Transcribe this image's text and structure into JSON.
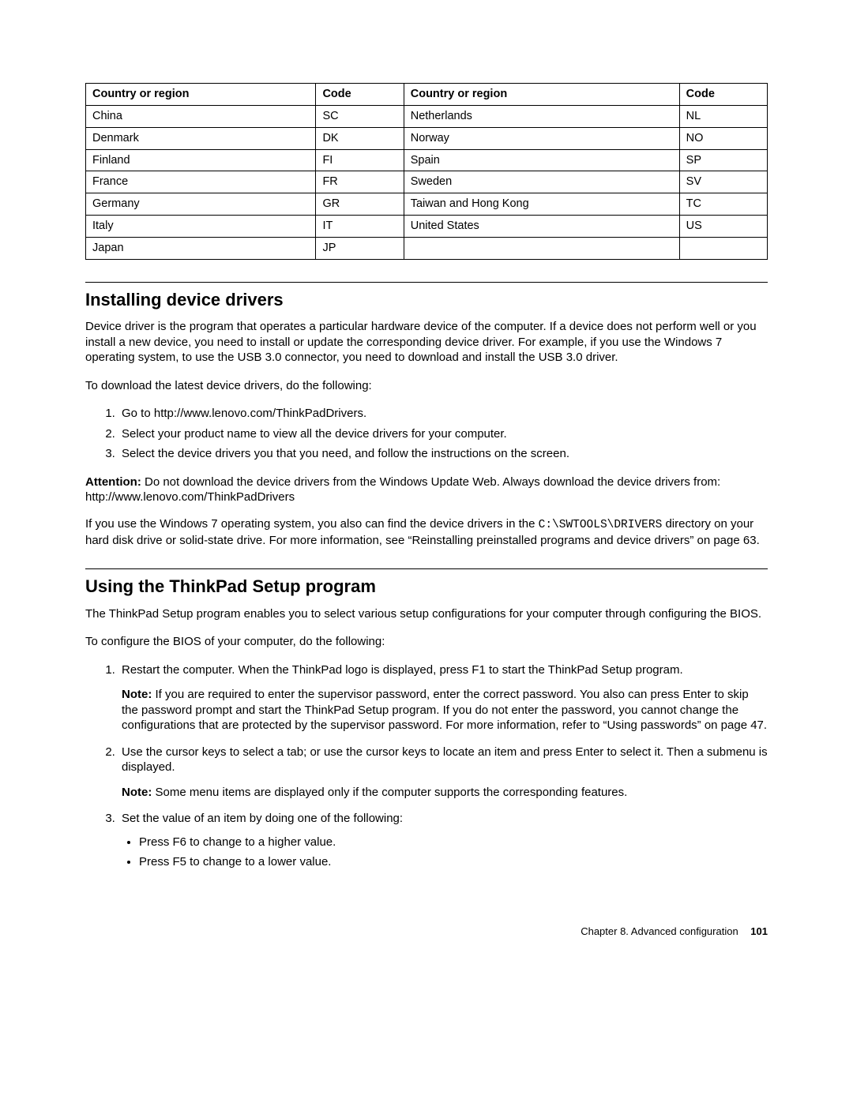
{
  "table": {
    "headers": [
      "Country or region",
      "Code",
      "Country or region",
      "Code"
    ],
    "rows": [
      [
        "China",
        "SC",
        "Netherlands",
        "NL"
      ],
      [
        "Denmark",
        "DK",
        "Norway",
        "NO"
      ],
      [
        "Finland",
        "FI",
        "Spain",
        "SP"
      ],
      [
        "France",
        "FR",
        "Sweden",
        "SV"
      ],
      [
        "Germany",
        "GR",
        "Taiwan and Hong Kong",
        "TC"
      ],
      [
        "Italy",
        "IT",
        "United States",
        "US"
      ],
      [
        "Japan",
        "JP",
        "",
        ""
      ]
    ]
  },
  "section1": {
    "heading": "Installing device drivers",
    "p1": "Device driver is the program that operates a particular hardware device of the computer. If a device does not perform well or you install a new device, you need to install or update the corresponding device driver. For example, if you use the Windows 7 operating system, to use the USB 3.0 connector, you need to download and install the USB 3.0 driver.",
    "p2": "To download the latest device drivers, do the following:",
    "ol": [
      "Go to http://www.lenovo.com/ThinkPadDrivers.",
      "Select your product name to view all the device drivers for your computer.",
      "Select the device drivers you that you need, and follow the instructions on the screen."
    ],
    "attention_label": "Attention:",
    "attention_text": " Do not download the device drivers from the Windows Update Web. Always download the device drivers from:",
    "attention_url": "http://www.lenovo.com/ThinkPadDrivers",
    "p3_a": "If you use the Windows 7 operating system, you also can find the device drivers in the ",
    "p3_mono": "C:\\SWTOOLS\\DRIVERS",
    "p3_b": " directory on your hard disk drive or solid-state drive. For more information, see “Reinstalling preinstalled programs and device drivers” on page 63."
  },
  "section2": {
    "heading": "Using the ThinkPad Setup program",
    "p1": "The ThinkPad Setup program enables you to select various setup configurations for your computer through configuring the BIOS.",
    "p2": "To configure the BIOS of your computer, do the following:",
    "step1": "Restart the computer. When the ThinkPad logo is displayed, press F1 to start the ThinkPad Setup program.",
    "step1_note_label": "Note:",
    "step1_note": " If you are required to enter the supervisor password, enter the correct password. You also can press Enter to skip the password prompt and start the ThinkPad Setup program. If you do not enter the password, you cannot change the configurations that are protected by the supervisor password. For more information, refer to “Using passwords” on page 47.",
    "step2": "Use the cursor keys to select a tab; or use the cursor keys to locate an item and press Enter to select it. Then a submenu is displayed.",
    "step2_note_label": "Note:",
    "step2_note": " Some menu items are displayed only if the computer supports the corresponding features.",
    "step3": "Set the value of an item by doing one of the following:",
    "step3_bullets": [
      "Press F6 to change to a higher value.",
      "Press F5 to change to a lower value."
    ]
  },
  "footer": {
    "chapter": "Chapter 8. Advanced configuration",
    "page": "101"
  }
}
